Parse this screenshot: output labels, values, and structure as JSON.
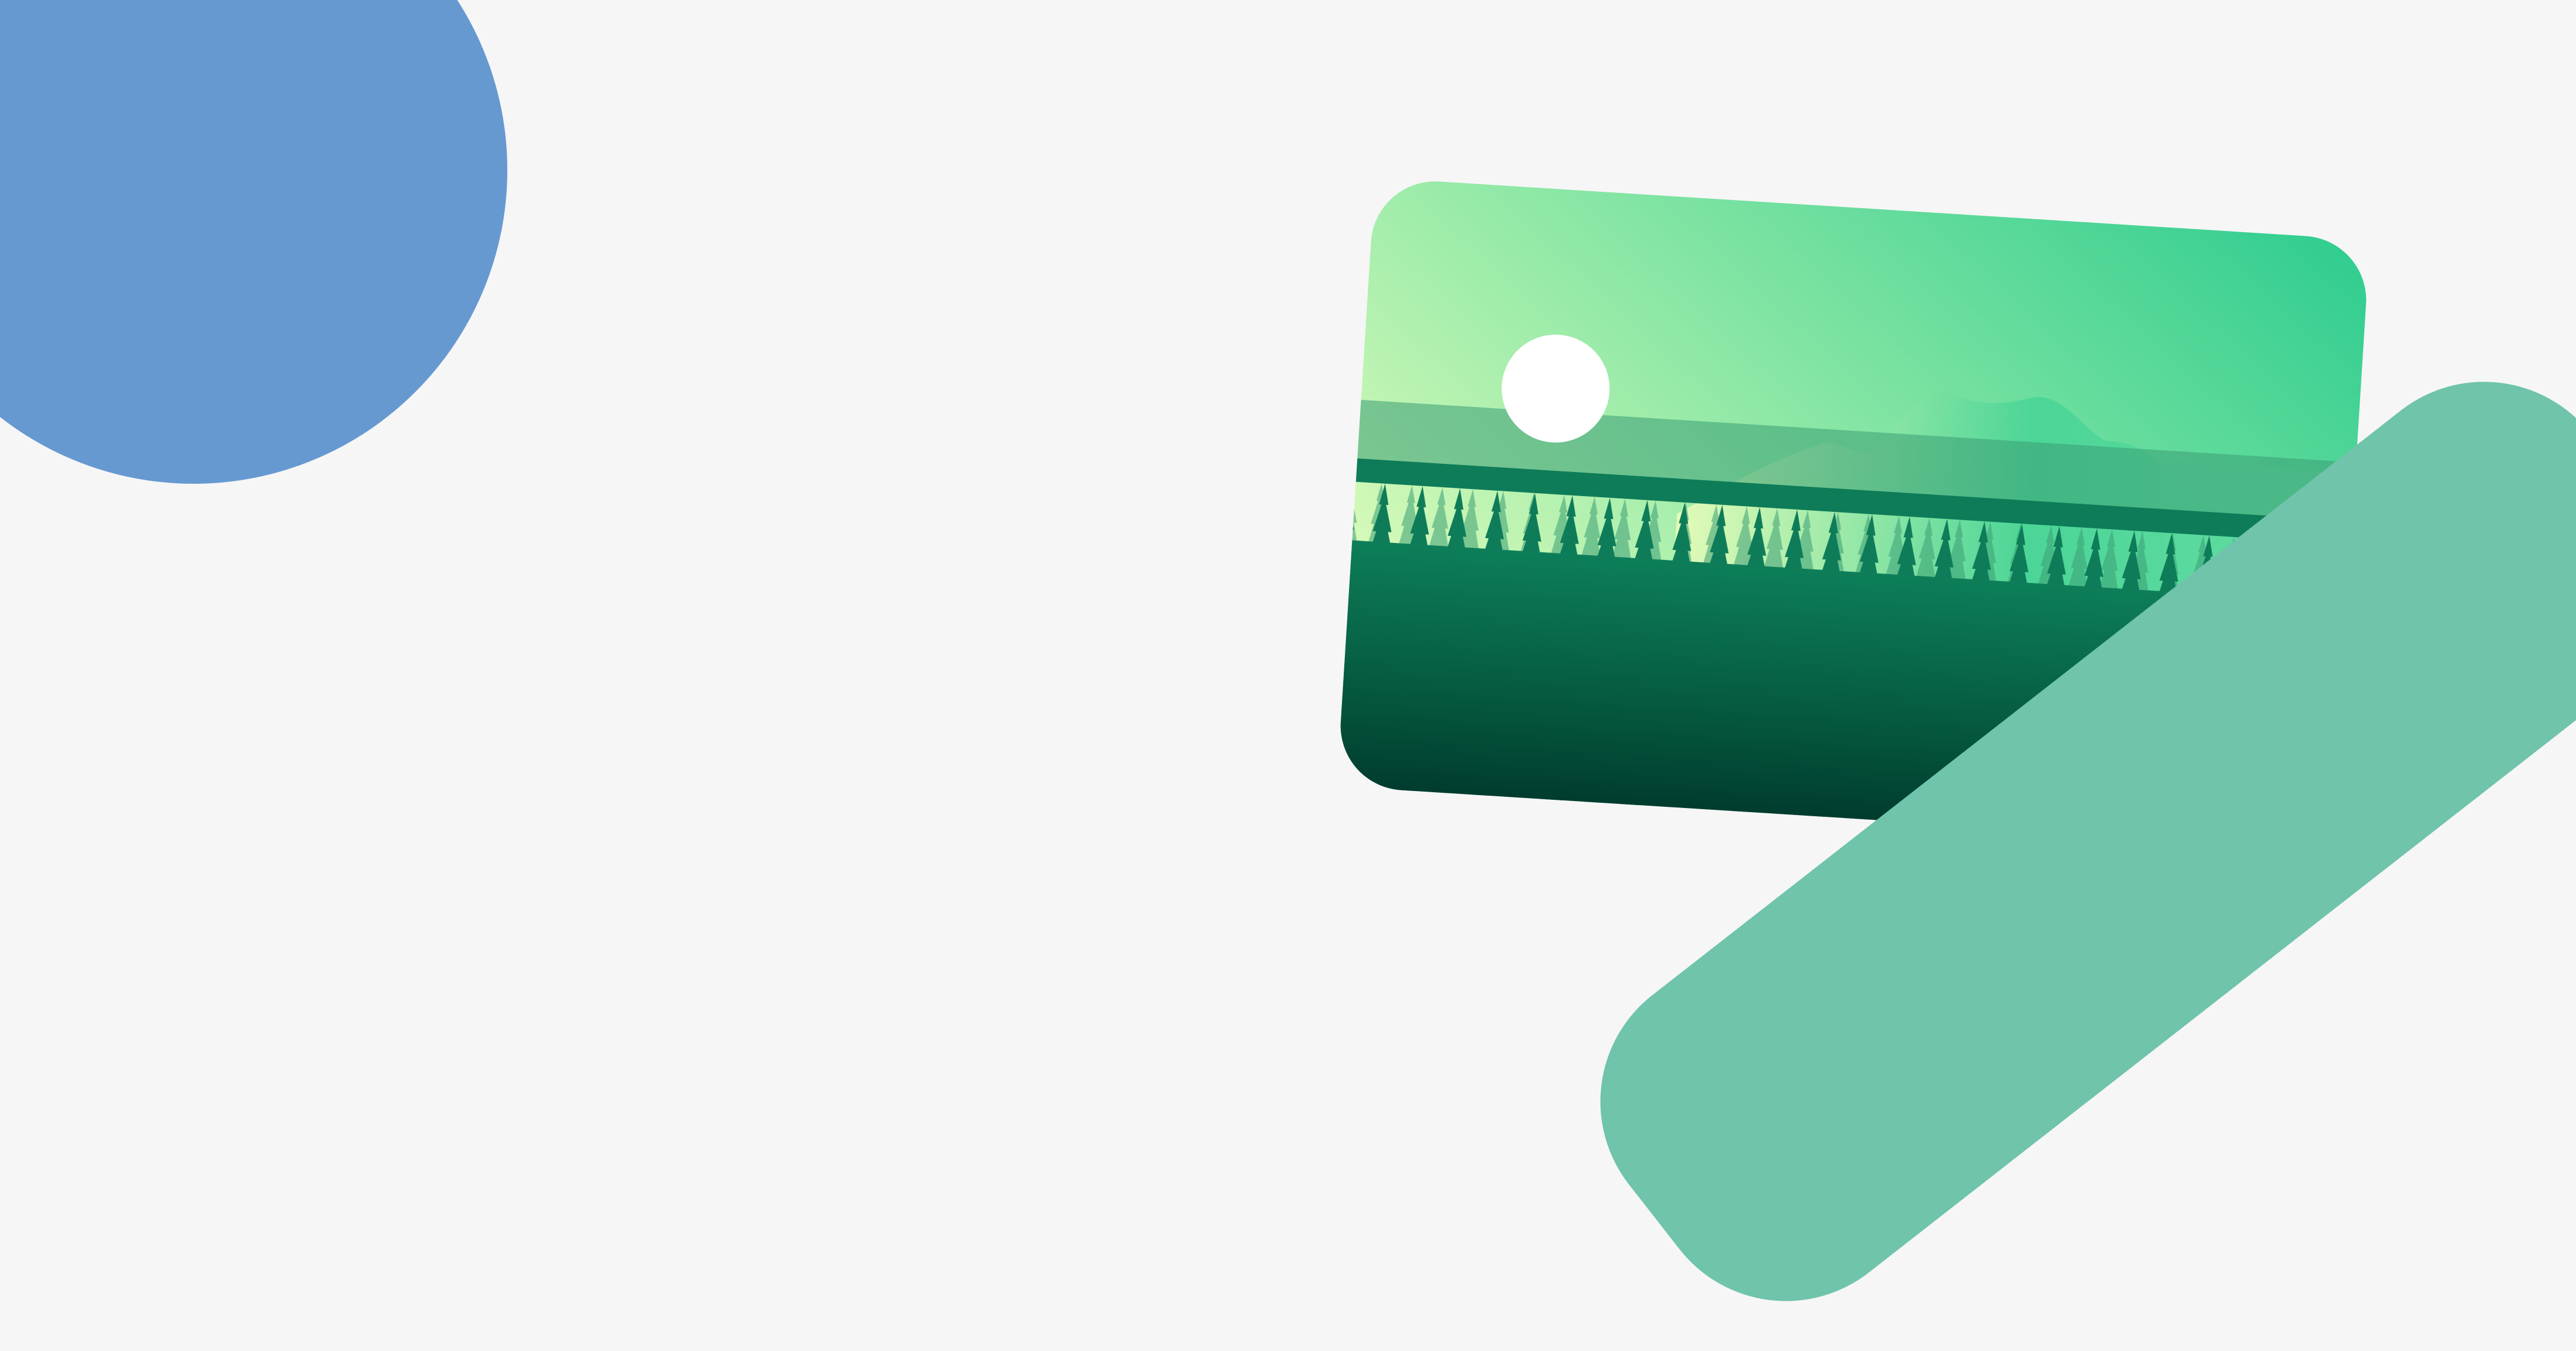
{
  "scene": {
    "background_color": "#f6f6f6",
    "circle_color": "#6799d1",
    "bar_color": "#6fc4ab",
    "sun_color": "#ffffff",
    "sky_colors": [
      "#2dcc8f",
      "#e3fdbc"
    ],
    "mountain_colors": [
      "#e3fbb8",
      "#4bd597"
    ],
    "forest_colors": [
      "#0d7e59",
      "#00352a"
    ],
    "card_icon": "landscape-photo-icon"
  }
}
